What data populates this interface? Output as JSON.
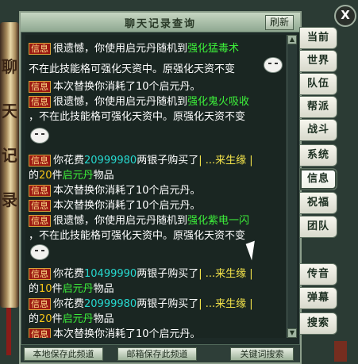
{
  "window": {
    "title": "聊天记录查询",
    "refresh_label": "刷新",
    "close_symbol": "X"
  },
  "scroll_text": [
    "聊",
    "天",
    "记",
    "录"
  ],
  "chat": {
    "tag": "信息",
    "lines": [
      {
        "text1": "很遗憾，你使用启元丹随机到",
        "green": "强化猛毒术"
      },
      {
        "text1": "不在此技能格可强化天资中。原强化天资不变"
      },
      {
        "text1": "本次替换你消耗了10个启元丹。"
      },
      {
        "text1": "很遗憾，你使用启元丹随机到",
        "green": "强化鬼火吸收"
      },
      {
        "text1": "，不在此技能格可强化天资中。原强化天资不变"
      },
      {
        "text1": "你花费",
        "cyan": "20999980",
        "text2": "两银子购买了",
        "yellow": "|  ...来生缘  |"
      },
      {
        "text1": "的",
        "orange": "20",
        "text2": "件",
        "green": "启元丹",
        "text3": "物品"
      },
      {
        "text1": "本次替换你消耗了10个启元丹。"
      },
      {
        "text1": "本次替换你消耗了10个启元丹。"
      },
      {
        "text1": "很遗憾，你使用启元丹随机到",
        "green": "强化紫电一闪"
      },
      {
        "text1": "，不在此技能格可强化天资中。原强化天资不变"
      },
      {
        "text1": "你花费",
        "cyan": "10499990",
        "text2": "两银子购买了",
        "yellow": "|  ...来生缘  |"
      },
      {
        "text1": "的",
        "orange": "10",
        "text2": "件",
        "green": "启元丹",
        "text3": "物品"
      },
      {
        "text1": "你花费",
        "cyan": "20999980",
        "text2": "两银子购买了",
        "yellow": "|  ...来生缘  |"
      },
      {
        "text1": "的",
        "orange": "20",
        "text2": "件",
        "green": "启元丹",
        "text3": "物品"
      },
      {
        "text1": "本次替换你消耗了10个启元丹。"
      },
      {
        "text1": "本次替换你消耗了10个启元丹。"
      }
    ]
  },
  "bottom_buttons": {
    "save_local": "本地保存此频道",
    "save_mail": "邮箱保存此频道",
    "keyword_search": "关键词搜索"
  },
  "side_tabs": [
    "当前",
    "世界",
    "队伍",
    "帮派",
    "战斗",
    "系统",
    "信息",
    "祝福",
    "团队",
    "传音",
    "弹幕",
    "搜索"
  ],
  "active_tab": "信息",
  "colors": {
    "tag_bg": "#9c1a12",
    "green_text": "#3df13a",
    "cyan_text": "#26d9d0",
    "yellow_text": "#f3e34a"
  }
}
